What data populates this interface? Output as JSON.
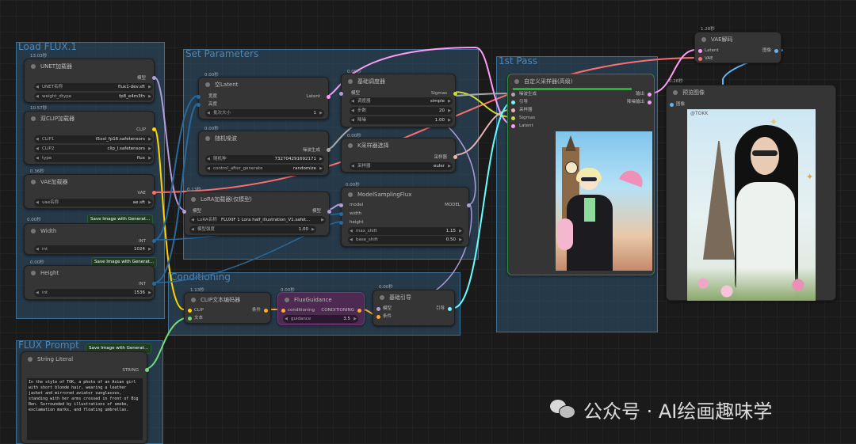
{
  "groups": {
    "load_flux": "Load FLUX.1",
    "set_params": "Set Parameters",
    "first_pass": "1st Pass",
    "conditioning": "Conditioning",
    "flux_prompt": "FLUX Prompt"
  },
  "nodes": {
    "unet": {
      "time": "13.03秒",
      "title": "UNET加载器",
      "out": "模型",
      "w1_label": "UNET名称",
      "w1_value": "flux1-dev.sft",
      "w2_label": "weight_dtype",
      "w2_value": "fp8_e4m3fn"
    },
    "dualclip": {
      "time": "10.57秒",
      "title": "双CLIP加载器",
      "out": "CLIP",
      "w1_label": "CLIP1",
      "w1_value": "t5xxl_fp16.safetensors",
      "w2_label": "CLIP2",
      "w2_value": "clip_l.safetensors",
      "w3_label": "type",
      "w3_value": "flux"
    },
    "vae": {
      "time": "0.36秒",
      "title": "VAE加载器",
      "out": "VAE",
      "w1_label": "vae名称",
      "w1_value": "ae.sft"
    },
    "width": {
      "time": "0.00秒",
      "title": "Width",
      "out": "INT",
      "w1_label": "int",
      "w1_value": "1024",
      "badge": "Save Image with Generat..."
    },
    "height": {
      "time": "0.00秒",
      "title": "Height",
      "out": "INT",
      "w1_label": "int",
      "w1_value": "1536",
      "badge": "Save Image with Generat..."
    },
    "latent": {
      "time": "0.00秒",
      "title": "空Latent",
      "in1": "宽度",
      "in2": "高度",
      "out": "Latent",
      "w1_label": "批次大小",
      "w1_value": "1"
    },
    "noise": {
      "time": "0.00秒",
      "title": "随机噪波",
      "out": "噪波生成",
      "w1_label": "随机种",
      "w1_value": "732704291692171",
      "w2_label": "control_after_generate",
      "w2_value": "randomize"
    },
    "scheduler": {
      "time": "0.00秒",
      "title": "基础调度器",
      "in1": "模型",
      "out": "Sigmas",
      "w1_label": "调度器",
      "w1_value": "simple",
      "w2_label": "步数",
      "w2_value": "20",
      "w3_label": "降噪",
      "w3_value": "1.00"
    },
    "sampler_select": {
      "time": "0.00秒",
      "title": "K采样器选择",
      "out": "采样器",
      "w1_label": "采样器",
      "w1_value": "euler"
    },
    "lora": {
      "time": "0.13秒",
      "title": "LoRA加载器(仅模型)",
      "in1": "模型",
      "out": "模型",
      "w1_label": "LoRA名称",
      "w1_value": "FLUXIF 1 Lora half_illustration_V1.safet...",
      "w2_label": "模型强度",
      "w2_value": "1.00"
    },
    "msf": {
      "time": "0.00秒",
      "title": "ModelSamplingFlux",
      "in1": "model",
      "in2": "width",
      "in3": "height",
      "out": "MODEL",
      "w1_label": "max_shift",
      "w1_value": "1.15",
      "w2_label": "base_shift",
      "w2_value": "0.50"
    },
    "custom_sampler": {
      "title": "自定义采样器(高级)",
      "in1": "噪波生成",
      "in2": "引导",
      "in3": "采样器",
      "in4": "Sigmas",
      "in5": "Latent",
      "out1": "输出",
      "out2": "降噪输出"
    },
    "vae_decode": {
      "time": "1.28秒",
      "title": "VAE解码",
      "in1": "Latent",
      "in2": "VAE",
      "out": "图像"
    },
    "preview": {
      "time": "0.28秒",
      "title": "预览图像",
      "in1": "图像",
      "watermark": "@TOKK"
    },
    "clip_encode": {
      "time": "1.13秒",
      "title": "CLIP文本编码器",
      "in1": "CLIP",
      "in2": "文本",
      "out": "条件"
    },
    "flux_guidance": {
      "time": "0.00秒",
      "title": "FluxGuidance",
      "in1": "conditioning",
      "out": "CONDITIONING",
      "w1_label": "guidance",
      "w1_value": "3.5"
    },
    "basic_guider": {
      "time": "0.00秒",
      "title": "基础引导",
      "in1": "模型",
      "in2": "条件",
      "out": "引导"
    },
    "string_literal": {
      "title": "String Literal",
      "out": "STRING",
      "badge": "Save Image with Generat...",
      "text": "In the style of TOK, a photo of an Asian girl with short blonde hair, wearing a leather jacket and mirrored aviator sunglasses, standing with her arms crossed in front of Big Ben. Surrounded by illustrations of smoke, exclamation marks, and floating umbrellas."
    }
  },
  "watermark": "公众号 · AI绘画趣味学",
  "colors": {
    "model": "#b39ddb",
    "clip": "#ffd500",
    "vae": "#ff6e6e",
    "latent": "#ff9cf9",
    "int": "#29699c",
    "conditioning": "#ffa931",
    "noise": "#aaaaaa",
    "sigmas": "#cddc39",
    "sampler": "#ecb4b4",
    "guider": "#66ffff",
    "image": "#64b5f6",
    "string": "#77dd77"
  }
}
